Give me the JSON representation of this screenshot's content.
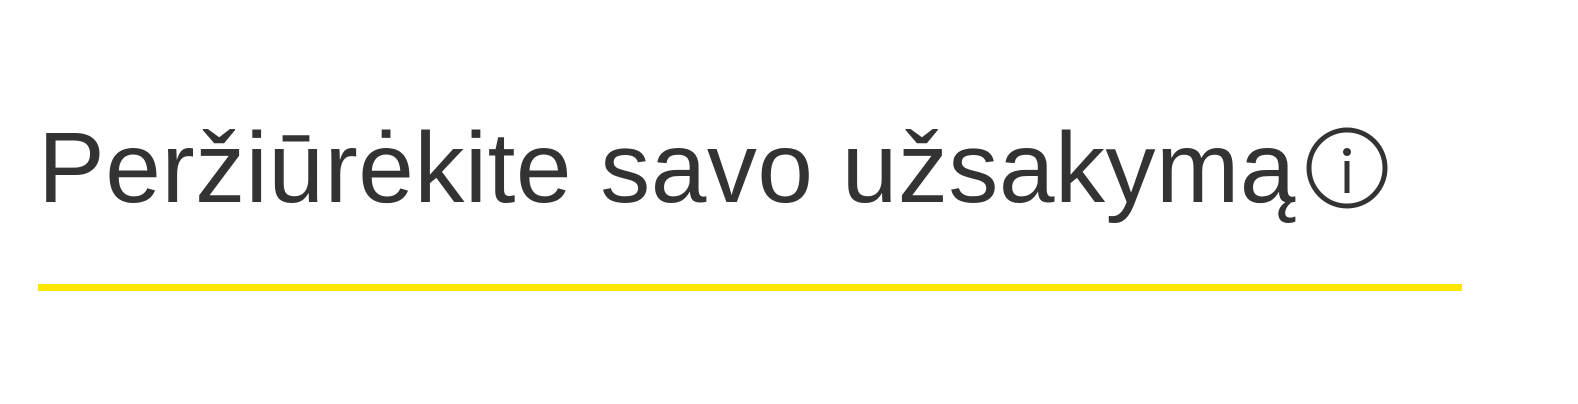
{
  "heading": {
    "title": "Peržiūrėkite savo užsakymą",
    "info_icon": "info-circle-icon",
    "text_color": "#333333"
  },
  "divider": {
    "color": "#ffe600"
  }
}
